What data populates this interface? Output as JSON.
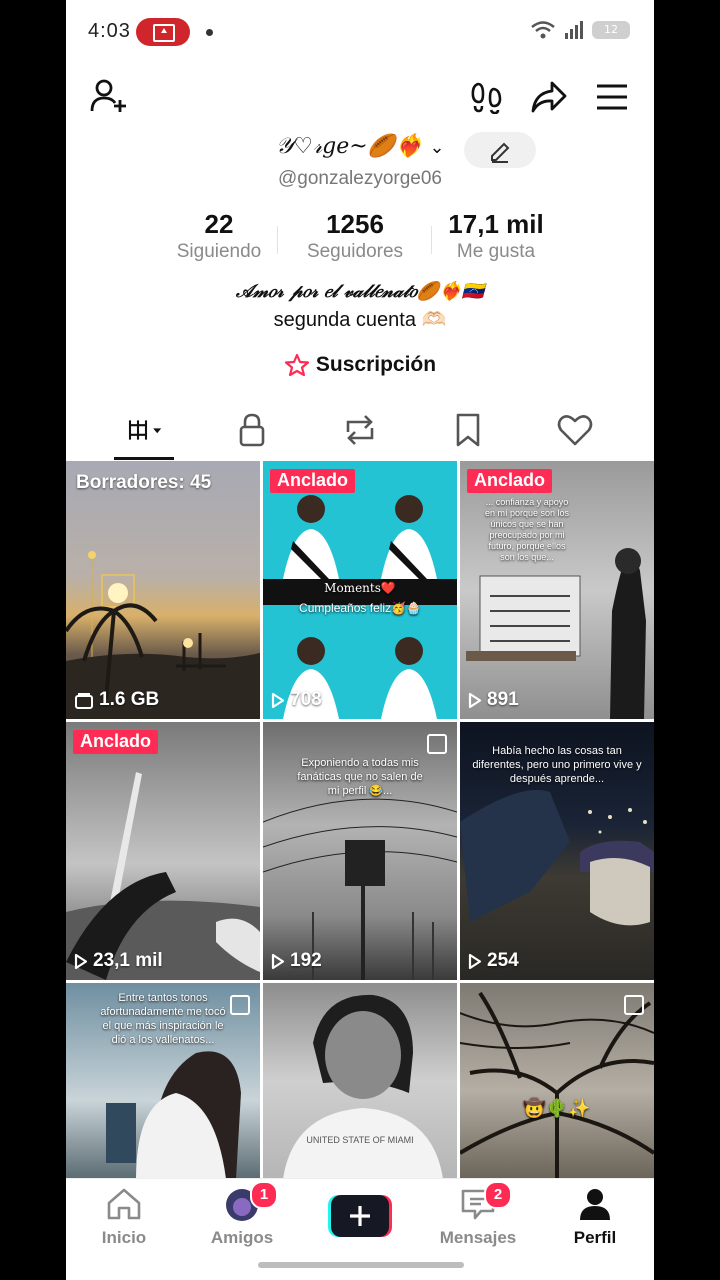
{
  "status_bar": {
    "time": "4:03",
    "battery": "12"
  },
  "profile": {
    "display_name": "𝒴♡𝓇ge~🏉❤️‍🔥",
    "username": "@gonzalezyorge06",
    "stats": [
      {
        "value": "22",
        "label": "Siguiendo"
      },
      {
        "value": "1256",
        "label": "Seguidores"
      },
      {
        "value": "17,1 mil",
        "label": "Me gusta"
      }
    ],
    "bio_line1": "𝒜𝓂𝑜𝓇 𝓅𝑜𝓇 𝑒𝓁 𝓋𝒶𝓁𝓁𝑒𝓃𝒶𝓉𝑜🏉❤️‍🔥🇻🇪",
    "bio_line2": "segunda cuenta 🫶🏻",
    "subscription": "Suscripción"
  },
  "grid": {
    "drafts": "Borradores: 45",
    "drafts_size": "1.6 GB",
    "pinned_label": "Anclado",
    "tiles": [
      {
        "views": "708",
        "caption1": "Moments❤️",
        "caption2": "Cumpleaños feliz🥳🧁"
      },
      {
        "views": "891",
        "caption": "... confianza y apoyo en mí porque son los únicos que se han preocupado por mi futuro, porque ellos son los que..."
      },
      {
        "views": "23,1 mil"
      },
      {
        "views": "192",
        "caption": "Exponiendo a todas mis fanáticas que no salen de mi perfil 😂..."
      },
      {
        "views": "254",
        "caption": "Había hecho las cosas tan diferentes, pero uno primero vive y después aprende..."
      },
      {
        "caption": "Entre tantos tonos afortunadamente me tocó el que más inspiración le dió a los vallenatos..."
      },
      {
        "caption": "UNITED STATE OF MIAMI"
      },
      {
        "caption": "🤠🌵✨"
      }
    ]
  },
  "nav": {
    "items": [
      {
        "label": "Inicio"
      },
      {
        "label": "Amigos",
        "badge": "1"
      },
      {
        "label": "Mensajes",
        "badge": "2"
      },
      {
        "label": "Perfil"
      }
    ]
  }
}
